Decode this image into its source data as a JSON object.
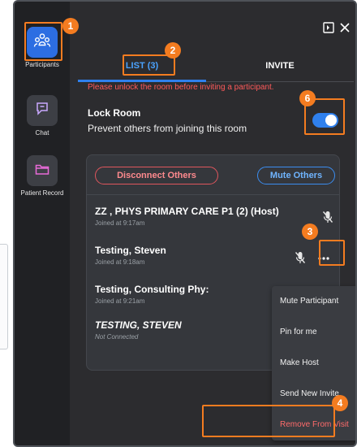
{
  "rail": {
    "items": [
      {
        "label": "Participants",
        "icon": "participants-icon",
        "active": true
      },
      {
        "label": "Chat",
        "icon": "chat-icon",
        "active": false
      },
      {
        "label": "Patient Record",
        "icon": "folder-icon",
        "active": false
      }
    ]
  },
  "header": {
    "icons": [
      "sidebar-toggle-icon",
      "close-icon"
    ]
  },
  "tabs": {
    "list": "LIST (3)",
    "invite": "INVITE"
  },
  "warning": "Please unlock the room before inviting a participant.",
  "lock_room": {
    "title": "Lock Room",
    "description": "Prevent others from joining this room",
    "enabled": true
  },
  "actions": {
    "disconnect_others": "Disconnect Others",
    "mute_others": "Mute Others"
  },
  "participants": [
    {
      "name": "ZZ , PHYS PRIMARY CARE P1 (2) (Host)",
      "sub": "Joined at 9:17am"
    },
    {
      "name": "Testing, Steven",
      "sub": "Joined at 9:18am"
    },
    {
      "name": "Testing, Consulting Phy:",
      "sub": "Joined at 9:21am"
    },
    {
      "name": "TESTING, STEVEN",
      "sub": "Not Connected"
    }
  ],
  "context_menu": {
    "items": [
      "Mute Participant",
      "Pin for me",
      "Make Host",
      "Send New Invite",
      "Remove From Visit"
    ]
  },
  "callouts": [
    "1",
    "2",
    "3",
    "4",
    "6"
  ],
  "colors": {
    "accent": "#2f80ed",
    "callout": "#f47c20",
    "danger": "#ff6b6b",
    "background": "#2c2c2f"
  }
}
